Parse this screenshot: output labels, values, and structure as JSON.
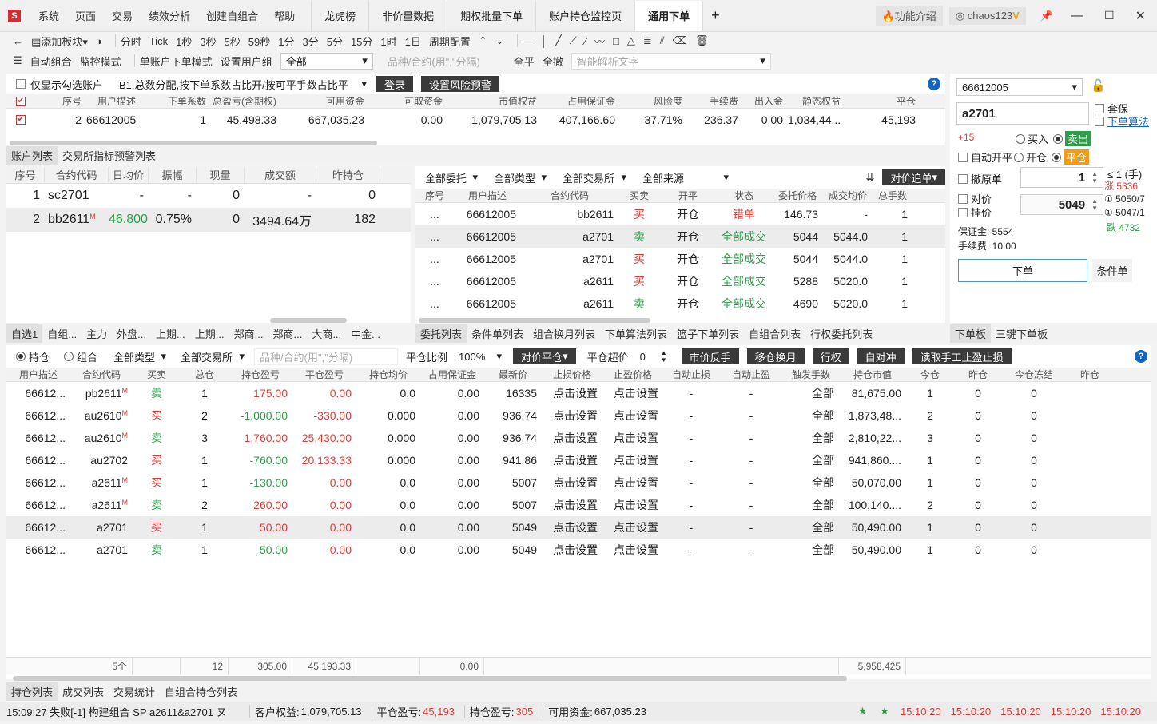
{
  "menu": [
    "系统",
    "页面",
    "交易",
    "绩效分析",
    "创建自组合",
    "帮助"
  ],
  "tabs": [
    "龙虎榜",
    "非价量数据",
    "期权批量下单",
    "账户持仓监控页",
    "通用下单"
  ],
  "top_right": {
    "feature": "功能介绍",
    "user": "chaos123"
  },
  "toolbar1": {
    "add_block": "添加板块",
    "periods": [
      "分时",
      "Tick",
      "1秒",
      "3秒",
      "5秒",
      "59秒",
      "1分",
      "3分",
      "5分",
      "15分",
      "1时",
      "1日",
      "周期配置"
    ]
  },
  "toolbar2": {
    "auto_combo": "自动组合",
    "monitor": "监控模式",
    "single_mode": "单账户下单模式",
    "set_group": "设置用户组",
    "group_value": "全部",
    "contract_placeholder": "品种/合约(用\",\"分隔)",
    "close_all": "全平",
    "cancel_all": "全撤",
    "smart_placeholder": "智能解析文字"
  },
  "account_bar": {
    "only_checked": "仅显示勾选账户",
    "strategy": "B1.总数分配,按下单系数占比开/按可平手数占比平",
    "login": "登录",
    "risk": "设置风险预警"
  },
  "account_table": {
    "headers": [
      "序号",
      "用户描述",
      "下单系数",
      "总盈亏(含期权)",
      "可用资金",
      "可取资金",
      "市值权益",
      "占用保证金",
      "风险度",
      "手续费",
      "出入金",
      "静态权益",
      "平仓"
    ],
    "row": [
      "2",
      "66612005",
      "1",
      "45,498.33",
      "667,035.23",
      "0.00",
      "1,079,705.13",
      "407,166.60",
      "37.71%",
      "236.37",
      "0.00",
      "1,034,44...",
      "45,193"
    ]
  },
  "account_tabs": [
    "账户列表",
    "交易所指标预警列表"
  ],
  "quote_table": {
    "headers": [
      "序号",
      "合约代码",
      "日均价",
      "振幅",
      "现量",
      "成交额",
      "昨持仓"
    ],
    "rows": [
      [
        "1",
        "sc2701",
        "",
        "-",
        "-",
        "0",
        "-",
        "0"
      ],
      [
        "2",
        "bb2611",
        "M",
        "46.800",
        "0.75%",
        "0",
        "3494.64万",
        "182"
      ]
    ]
  },
  "quote_tabs": [
    "自选1",
    "自组...",
    "主力",
    "外盘...",
    "上期...",
    "上期...",
    "郑商...",
    "郑商...",
    "大商...",
    "中金..."
  ],
  "order_filters": {
    "a": "全部委托",
    "b": "全部类型",
    "c": "全部交易所",
    "d": "全部来源",
    "chase": "对价追单"
  },
  "order_table": {
    "headers": [
      "序号",
      "用户描述",
      "合约代码",
      "买卖",
      "开平",
      "状态",
      "委托价格",
      "成交均价",
      "总手数"
    ],
    "rows": [
      [
        "...",
        "66612005",
        "bb2611",
        "买",
        "开仓",
        "错单",
        "146.73",
        "-",
        "1"
      ],
      [
        "...",
        "66612005",
        "a2701",
        "卖",
        "开仓",
        "全部成交",
        "5044",
        "5044.0",
        "1"
      ],
      [
        "...",
        "66612005",
        "a2701",
        "买",
        "开仓",
        "全部成交",
        "5044",
        "5044.0",
        "1"
      ],
      [
        "...",
        "66612005",
        "a2611",
        "买",
        "开仓",
        "全部成交",
        "5288",
        "5020.0",
        "1"
      ],
      [
        "...",
        "66612005",
        "a2611",
        "卖",
        "开仓",
        "全部成交",
        "4690",
        "5020.0",
        "1"
      ]
    ]
  },
  "order_tabs": [
    "委托列表",
    "条件单列表",
    "组合换月列表",
    "下单算法列表",
    "篮子下单列表",
    "自组合列表",
    "行权委托列表"
  ],
  "order_panel": {
    "account": "66612005",
    "contract": "a2701",
    "hedge": "套保",
    "algo": "下单算法",
    "offset": "+15",
    "buy": "买入",
    "sell": "卖出",
    "auto_oc": "自动开平",
    "open": "开仓",
    "close": "平仓",
    "cancel_orig": "撤原单",
    "qty": "1",
    "max_qty": "≤ 1 (手)",
    "limit_up": "涨 5336",
    "opp": "对价",
    "hang": "挂价",
    "price": "5049",
    "ask": "5050/7",
    "bid": "5047/1",
    "limit_down": "跌 4732",
    "margin": "保证金: 5554",
    "fee": "手续费: 10.00",
    "submit": "下单",
    "cond": "条件单"
  },
  "panel_tabs": [
    "下单板",
    "三键下单板"
  ],
  "pos_bar": {
    "hold": "持仓",
    "combo": "组合",
    "type": "全部类型",
    "exch": "全部交易所",
    "placeholder": "品种/合约(用\",\"分隔)",
    "ratio_label": "平仓比例",
    "ratio": "100%",
    "opp_close": "对价平仓",
    "over_label": "平仓超价",
    "over": "0",
    "rev": "市价反手",
    "roll": "移仓换月",
    "exercise": "行权",
    "hedge": "自对冲",
    "read": "读取手工止盈止损"
  },
  "pos_table": {
    "headers": [
      "用户描述",
      "合约代码",
      "买卖",
      "总仓",
      "持仓盈亏",
      "平仓盈亏",
      "持仓均价",
      "占用保证金",
      "最新价",
      "止损价格",
      "止盈价格",
      "自动止损",
      "自动止盈",
      "触发手数",
      "持仓市值",
      "今仓",
      "昨仓",
      "今仓冻结",
      "昨仓"
    ],
    "rows": [
      [
        "66612...",
        "pb2611",
        "M",
        "卖",
        "1",
        "175.00",
        "0.00",
        "0.0",
        "0.00",
        "16335",
        "点击设置",
        "点击设置",
        "-",
        "-",
        "全部",
        "81,675.00",
        "1",
        "0",
        "0"
      ],
      [
        "66612...",
        "au2610",
        "M",
        "买",
        "2",
        "-1,000.00",
        "-330.00",
        "0.000",
        "0.00",
        "936.74",
        "点击设置",
        "点击设置",
        "-",
        "-",
        "全部",
        "1,873,48...",
        "2",
        "0",
        "0"
      ],
      [
        "66612...",
        "au2610",
        "M",
        "卖",
        "3",
        "1,760.00",
        "25,430.00",
        "0.000",
        "0.00",
        "936.74",
        "点击设置",
        "点击设置",
        "-",
        "-",
        "全部",
        "2,810,22...",
        "3",
        "0",
        "0"
      ],
      [
        "66612...",
        "au2702",
        "",
        "买",
        "1",
        "-760.00",
        "20,133.33",
        "0.000",
        "0.00",
        "941.86",
        "点击设置",
        "点击设置",
        "-",
        "-",
        "全部",
        "941,860....",
        "1",
        "0",
        "0"
      ],
      [
        "66612...",
        "a2611",
        "M",
        "买",
        "1",
        "-130.00",
        "0.00",
        "0.0",
        "0.00",
        "5007",
        "点击设置",
        "点击设置",
        "-",
        "-",
        "全部",
        "50,070.00",
        "1",
        "0",
        "0"
      ],
      [
        "66612...",
        "a2611",
        "M",
        "卖",
        "2",
        "260.00",
        "0.00",
        "0.0",
        "0.00",
        "5007",
        "点击设置",
        "点击设置",
        "-",
        "-",
        "全部",
        "100,140....",
        "2",
        "0",
        "0"
      ],
      [
        "66612...",
        "a2701",
        "",
        "买",
        "1",
        "50.00",
        "0.00",
        "0.0",
        "0.00",
        "5049",
        "点击设置",
        "点击设置",
        "-",
        "-",
        "全部",
        "50,490.00",
        "1",
        "0",
        "0"
      ],
      [
        "66612...",
        "a2701",
        "",
        "卖",
        "1",
        "-50.00",
        "0.00",
        "0.0",
        "0.00",
        "5049",
        "点击设置",
        "点击设置",
        "-",
        "-",
        "全部",
        "50,490.00",
        "1",
        "0",
        "0"
      ]
    ],
    "totals": {
      "count": "5个",
      "total": "12",
      "pnl": "305.00",
      "close": "45,193.33",
      "margin": "0.00",
      "value": "5,958,425"
    }
  },
  "pos_tabs": [
    "持仓列表",
    "成交列表",
    "交易统计",
    "自组合持仓列表"
  ],
  "status": {
    "msg": "15:09:27 失败[-1] 构建组合 SP a2611&a2701 ヌ",
    "equity_label": "客户权益:",
    "equity": "1,079,705.13",
    "close_pnl_label": "平仓盈亏:",
    "close_pnl": "45,193",
    "hold_pnl_label": "持仓盈亏:",
    "hold_pnl": "305",
    "avail_label": "可用资金:",
    "avail": "667,035.23",
    "times": [
      "15:10:20",
      "15:10:20",
      "15:10:20",
      "15:10:20",
      "15:10:20"
    ]
  }
}
